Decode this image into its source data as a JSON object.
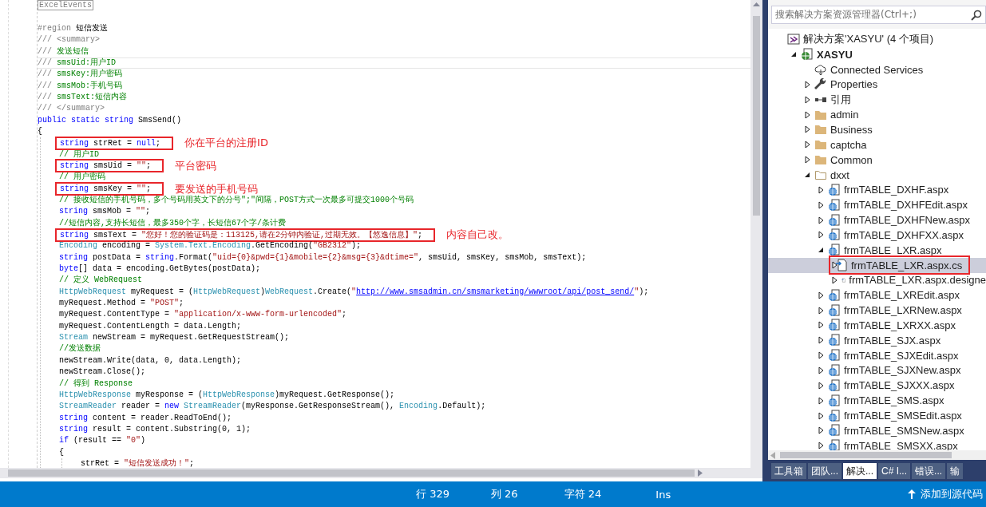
{
  "editor": {
    "lines": [
      {
        "tokens": [
          {
            "kind": "collapsed",
            "text": "ExcelEvents"
          }
        ]
      },
      {
        "tokens": [
          {
            "kind": "region",
            "text": "#region "
          },
          {
            "kind": "plain",
            "text": "短信发送"
          }
        ]
      },
      {
        "tokens": [
          {
            "kind": "doc",
            "text": "/// <summary>"
          }
        ]
      },
      {
        "tokens": [
          {
            "kind": "doc",
            "text": "/// "
          },
          {
            "kind": "comment",
            "text": "发送短信"
          }
        ]
      },
      {
        "current": true,
        "tokens": [
          {
            "kind": "doc",
            "text": "/// "
          },
          {
            "kind": "comment",
            "text": "smsUid:用户ID"
          }
        ]
      },
      {
        "tokens": [
          {
            "kind": "doc",
            "text": "/// "
          },
          {
            "kind": "comment",
            "text": "smsKey:用户密码"
          }
        ]
      },
      {
        "tokens": [
          {
            "kind": "doc",
            "text": "/// "
          },
          {
            "kind": "comment",
            "text": "smsMob:手机号码"
          }
        ]
      },
      {
        "tokens": [
          {
            "kind": "doc",
            "text": "/// "
          },
          {
            "kind": "comment",
            "text": "smsText:短信内容"
          }
        ]
      },
      {
        "tokens": [
          {
            "kind": "doc",
            "text": "/// </summary>"
          }
        ]
      },
      {
        "tokens": [
          {
            "kind": "keyword",
            "text": "public static string "
          },
          {
            "kind": "plain",
            "text": "SmsSend()"
          }
        ]
      },
      {
        "tokens": [
          {
            "kind": "plain",
            "text": "{"
          }
        ],
        "children": [
          {
            "boxed": true,
            "note": "你在平台的注册ID",
            "tokens": [
              {
                "kind": "keyword",
                "text": "string "
              },
              {
                "kind": "plain",
                "text": "strRet = "
              },
              {
                "kind": "keyword",
                "text": "null"
              },
              {
                "kind": "plain",
                "text": ";"
              }
            ]
          },
          {
            "tokens": [
              {
                "kind": "comment",
                "text": "// 用户ID"
              }
            ]
          },
          {
            "boxed": true,
            "note": "平台密码",
            "tokens": [
              {
                "kind": "keyword",
                "text": "string "
              },
              {
                "kind": "plain",
                "text": "smsUid = "
              },
              {
                "kind": "string",
                "text": "\"\""
              },
              {
                "kind": "plain",
                "text": ";"
              }
            ]
          },
          {
            "tokens": [
              {
                "kind": "comment",
                "text": "// 用户密码"
              }
            ]
          },
          {
            "boxed": true,
            "note": "要发送的手机号码",
            "tokens": [
              {
                "kind": "keyword",
                "text": "string "
              },
              {
                "kind": "plain",
                "text": "smsKey = "
              },
              {
                "kind": "string",
                "text": "\"\""
              },
              {
                "kind": "plain",
                "text": ";"
              }
            ]
          },
          {
            "tokens": [
              {
                "kind": "comment",
                "text": "// 接收短信的手机号码，多个号码用英文下的分号\";\"间隔，POST方式一次最多可提交1000个号码"
              }
            ]
          },
          {
            "tokens": [
              {
                "kind": "keyword",
                "text": "string "
              },
              {
                "kind": "plain",
                "text": "smsMob = "
              },
              {
                "kind": "string",
                "text": "\"\""
              },
              {
                "kind": "plain",
                "text": ";"
              }
            ]
          },
          {
            "tokens": [
              {
                "kind": "comment",
                "text": "//短信内容,支持长短信，最多350个字，长短信67个字/条计费"
              }
            ]
          },
          {
            "boxed": true,
            "note": "内容自己改。",
            "tokens": [
              {
                "kind": "keyword",
                "text": "string "
              },
              {
                "kind": "plain",
                "text": "smsText = "
              },
              {
                "kind": "string",
                "text": "\"您好！您的验证码是：113125,请在2分钟内验证,过期无效。【悠逸信息】\""
              },
              {
                "kind": "plain",
                "text": ";"
              }
            ]
          },
          {
            "tokens": [
              {
                "kind": "type",
                "text": "Encoding"
              },
              {
                "kind": "plain",
                "text": " encoding = "
              },
              {
                "kind": "type",
                "text": "System.Text.Encoding"
              },
              {
                "kind": "plain",
                "text": ".GetEncoding("
              },
              {
                "kind": "string",
                "text": "\"GB2312\""
              },
              {
                "kind": "plain",
                "text": ");"
              }
            ]
          },
          {
            "tokens": [
              {
                "kind": "keyword",
                "text": "string "
              },
              {
                "kind": "plain",
                "text": "postData = "
              },
              {
                "kind": "keyword",
                "text": "string"
              },
              {
                "kind": "plain",
                "text": ".Format("
              },
              {
                "kind": "string",
                "text": "\"uid={0}&pwd={1}&mobile={2}&msg={3}&dtime=\""
              },
              {
                "kind": "plain",
                "text": ", smsUid, smsKey, smsMob, smsText);"
              }
            ]
          },
          {
            "tokens": [
              {
                "kind": "keyword",
                "text": "byte"
              },
              {
                "kind": "plain",
                "text": "[] data = encoding.GetBytes(postData);"
              }
            ]
          },
          {
            "tokens": [
              {
                "kind": "comment",
                "text": "// 定义 WebRequest"
              }
            ]
          },
          {
            "tokens": [
              {
                "kind": "type",
                "text": "HttpWebRequest"
              },
              {
                "kind": "plain",
                "text": " myRequest = ("
              },
              {
                "kind": "type",
                "text": "HttpWebRequest"
              },
              {
                "kind": "plain",
                "text": ")"
              },
              {
                "kind": "type",
                "text": "WebRequest"
              },
              {
                "kind": "plain",
                "text": ".Create("
              },
              {
                "kind": "string",
                "text": "\""
              },
              {
                "kind": "link",
                "text": "http://www.smsadmin.cn/smsmarketing/wwwroot/api/post_send/"
              },
              {
                "kind": "string",
                "text": "\""
              },
              {
                "kind": "plain",
                "text": ");"
              }
            ]
          },
          {
            "tokens": [
              {
                "kind": "plain",
                "text": "myRequest.Method = "
              },
              {
                "kind": "string",
                "text": "\"POST\""
              },
              {
                "kind": "plain",
                "text": ";"
              }
            ]
          },
          {
            "tokens": [
              {
                "kind": "plain",
                "text": "myRequest.ContentType = "
              },
              {
                "kind": "string",
                "text": "\"application/x-www-form-urlencoded\""
              },
              {
                "kind": "plain",
                "text": ";"
              }
            ]
          },
          {
            "tokens": [
              {
                "kind": "plain",
                "text": "myRequest.ContentLength = data.Length;"
              }
            ]
          },
          {
            "tokens": [
              {
                "kind": "type",
                "text": "Stream"
              },
              {
                "kind": "plain",
                "text": " newStream = myRequest.GetRequestStream();"
              }
            ]
          },
          {
            "tokens": [
              {
                "kind": "comment",
                "text": "//发送数据"
              }
            ]
          },
          {
            "tokens": [
              {
                "kind": "plain",
                "text": "newStream.Write(data, 0, data.Length);"
              }
            ]
          },
          {
            "tokens": [
              {
                "kind": "plain",
                "text": "newStream.Close();"
              }
            ]
          },
          {
            "tokens": [
              {
                "kind": "comment",
                "text": "// 得到 Response"
              }
            ]
          },
          {
            "tokens": [
              {
                "kind": "type",
                "text": "HttpWebResponse"
              },
              {
                "kind": "plain",
                "text": " myResponse = ("
              },
              {
                "kind": "type",
                "text": "HttpWebResponse"
              },
              {
                "kind": "plain",
                "text": ")myRequest.GetResponse();"
              }
            ]
          },
          {
            "tokens": [
              {
                "kind": "type",
                "text": "StreamReader"
              },
              {
                "kind": "plain",
                "text": " reader = "
              },
              {
                "kind": "keyword",
                "text": "new "
              },
              {
                "kind": "type",
                "text": "StreamReader"
              },
              {
                "kind": "plain",
                "text": "(myResponse.GetResponseStream(), "
              },
              {
                "kind": "type",
                "text": "Encoding"
              },
              {
                "kind": "plain",
                "text": ".Default);"
              }
            ]
          },
          {
            "tokens": [
              {
                "kind": "keyword",
                "text": "string "
              },
              {
                "kind": "plain",
                "text": "content = reader.ReadToEnd();"
              }
            ]
          },
          {
            "tokens": [
              {
                "kind": "keyword",
                "text": "string "
              },
              {
                "kind": "plain",
                "text": "result = content.Substring(0, 1);"
              }
            ]
          },
          {
            "tokens": [
              {
                "kind": "keyword",
                "text": "if"
              },
              {
                "kind": "plain",
                "text": " (result == "
              },
              {
                "kind": "string",
                "text": "\"0\""
              },
              {
                "kind": "plain",
                "text": ")"
              }
            ]
          },
          {
            "tokens": [
              {
                "kind": "plain",
                "text": "{"
              }
            ],
            "children": [
              {
                "tokens": [
                  {
                    "kind": "plain",
                    "text": "strRet = "
                  },
                  {
                    "kind": "string",
                    "text": "\"短信发送成功！\""
                  },
                  {
                    "kind": "plain",
                    "text": ";"
                  }
                ]
              }
            ]
          }
        ]
      }
    ]
  },
  "solution_explorer": {
    "search": {
      "placeholder": "搜索解决方案资源管理器(Ctrl+;)"
    },
    "tree": [
      {
        "label": "解决方案'XASYU' (4 个项目)",
        "kind": "solution",
        "selected": false,
        "boxed": false,
        "children": [
          {
            "label": "XASYU",
            "kind": "project",
            "expanded": true,
            "selected": false,
            "boxed": false,
            "children": [
              {
                "label": "Connected Services",
                "kind": "cloud",
                "selected": false,
                "boxed": false
              },
              {
                "label": "Properties",
                "kind": "wrench",
                "expanded": false,
                "selected": false,
                "boxed": false
              },
              {
                "label": "引用",
                "kind": "reference",
                "expanded": false,
                "selected": false,
                "boxed": false
              },
              {
                "label": "admin",
                "kind": "folder",
                "expanded": false,
                "selected": false,
                "boxed": false
              },
              {
                "label": "Business",
                "kind": "folder",
                "expanded": false,
                "selected": false,
                "boxed": false
              },
              {
                "label": "captcha",
                "kind": "folder",
                "expanded": false,
                "selected": false,
                "boxed": false
              },
              {
                "label": "Common",
                "kind": "folder",
                "expanded": false,
                "selected": false,
                "boxed": false
              },
              {
                "label": "dxxt",
                "kind": "folder-open",
                "expanded": true,
                "selected": false,
                "boxed": false,
                "children": [
                  {
                    "label": "frmTABLE_DXHF.aspx",
                    "kind": "web",
                    "expanded": false,
                    "selected": false,
                    "boxed": false
                  },
                  {
                    "label": "frmTABLE_DXHFEdit.aspx",
                    "kind": "web",
                    "expanded": false,
                    "selected": false,
                    "boxed": false
                  },
                  {
                    "label": "frmTABLE_DXHFNew.aspx",
                    "kind": "web",
                    "expanded": false,
                    "selected": false,
                    "boxed": false
                  },
                  {
                    "label": "frmTABLE_DXHFXX.aspx",
                    "kind": "web",
                    "expanded": false,
                    "selected": false,
                    "boxed": false
                  },
                  {
                    "label": "frmTABLE_LXR.aspx",
                    "kind": "web",
                    "expanded": true,
                    "selected": false,
                    "boxed": false,
                    "children": [
                      {
                        "label": "frmTABLE_LXR.aspx.cs",
                        "kind": "code",
                        "expanded": false,
                        "selected": true,
                        "boxed": true
                      },
                      {
                        "label": "frmTABLE_LXR.aspx.designe",
                        "kind": "code",
                        "expanded": false,
                        "selected": false,
                        "boxed": false
                      }
                    ]
                  },
                  {
                    "label": "frmTABLE_LXREdit.aspx",
                    "kind": "web",
                    "expanded": false,
                    "selected": false,
                    "boxed": false
                  },
                  {
                    "label": "frmTABLE_LXRNew.aspx",
                    "kind": "web",
                    "expanded": false,
                    "selected": false,
                    "boxed": false
                  },
                  {
                    "label": "frmTABLE_LXRXX.aspx",
                    "kind": "web",
                    "expanded": false,
                    "selected": false,
                    "boxed": false
                  },
                  {
                    "label": "frmTABLE_SJX.aspx",
                    "kind": "web",
                    "expanded": false,
                    "selected": false,
                    "boxed": false
                  },
                  {
                    "label": "frmTABLE_SJXEdit.aspx",
                    "kind": "web",
                    "expanded": false,
                    "selected": false,
                    "boxed": false
                  },
                  {
                    "label": "frmTABLE_SJXNew.aspx",
                    "kind": "web",
                    "expanded": false,
                    "selected": false,
                    "boxed": false
                  },
                  {
                    "label": "frmTABLE_SJXXX.aspx",
                    "kind": "web",
                    "expanded": false,
                    "selected": false,
                    "boxed": false
                  },
                  {
                    "label": "frmTABLE_SMS.aspx",
                    "kind": "web",
                    "expanded": false,
                    "selected": false,
                    "boxed": false
                  },
                  {
                    "label": "frmTABLE_SMSEdit.aspx",
                    "kind": "web",
                    "expanded": false,
                    "selected": false,
                    "boxed": false
                  },
                  {
                    "label": "frmTABLE_SMSNew.aspx",
                    "kind": "web",
                    "expanded": false,
                    "selected": false,
                    "boxed": false
                  },
                  {
                    "label": "frmTABLE_SMSXX.aspx",
                    "kind": "web",
                    "expanded": false,
                    "selected": false,
                    "boxed": false
                  }
                ]
              }
            ]
          }
        ]
      }
    ],
    "tabs": [
      {
        "label": "工具箱",
        "selected": false
      },
      {
        "label": "团队...",
        "selected": false
      },
      {
        "label": "解决...",
        "selected": true
      },
      {
        "label": "C# I...",
        "selected": false
      },
      {
        "label": "错误...",
        "selected": false
      },
      {
        "label": "输",
        "selected": false
      }
    ]
  },
  "status_bar": {
    "line": "行 329",
    "column": "列 26",
    "char": "字符 24",
    "mode": "Ins",
    "source_control": "添加到源代码"
  }
}
